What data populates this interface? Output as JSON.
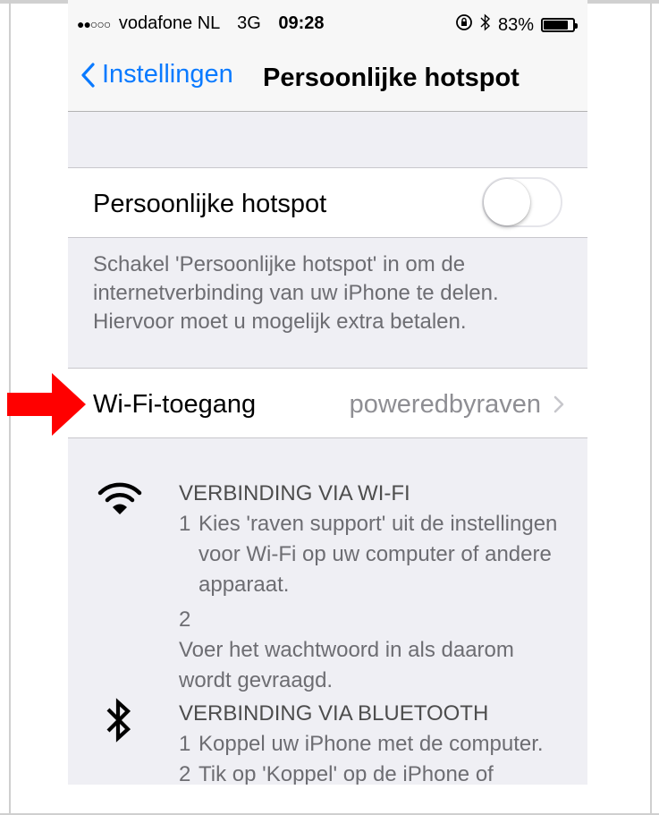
{
  "statusbar": {
    "signal_dots": "●●○○○",
    "carrier": "vodafone NL",
    "network": "3G",
    "time": "09:28",
    "battery": "83%",
    "battery_level": 0.83,
    "icons": [
      "rotation-lock-icon",
      "bluetooth-icon",
      "battery-icon"
    ]
  },
  "navbar": {
    "back_label": "Instellingen",
    "title": "Persoonlijke hotspot"
  },
  "hotspot": {
    "label": "Persoonlijke hotspot",
    "toggle_on": false,
    "footer": "Schakel 'Persoonlijke hotspot' in om de internetverbinding van uw iPhone te delen. Hiervoor moet u mogelijk extra betalen."
  },
  "wifi_access": {
    "label": "Wi-Fi-toegang",
    "value": "poweredbyraven"
  },
  "wifi_section": {
    "title": "VERBINDING VIA WI-FI",
    "steps": [
      {
        "num": "1",
        "text": "Kies 'raven support' uit de instellingen voor Wi-Fi op uw computer of andere apparaat."
      },
      {
        "num": "2",
        "text": "Voer het wachtwoord in als daarom wordt gevraagd."
      }
    ]
  },
  "bluetooth_section": {
    "title": "VERBINDING VIA BLUETOOTH",
    "steps": [
      {
        "num": "1",
        "text": "Koppel uw iPhone met de computer."
      },
      {
        "num": "2",
        "text": "Tik op 'Koppel' op de iPhone of"
      }
    ]
  },
  "colors": {
    "accent": "#0a7aff",
    "arrow": "#ff0000",
    "group_background": "#efeff4"
  }
}
